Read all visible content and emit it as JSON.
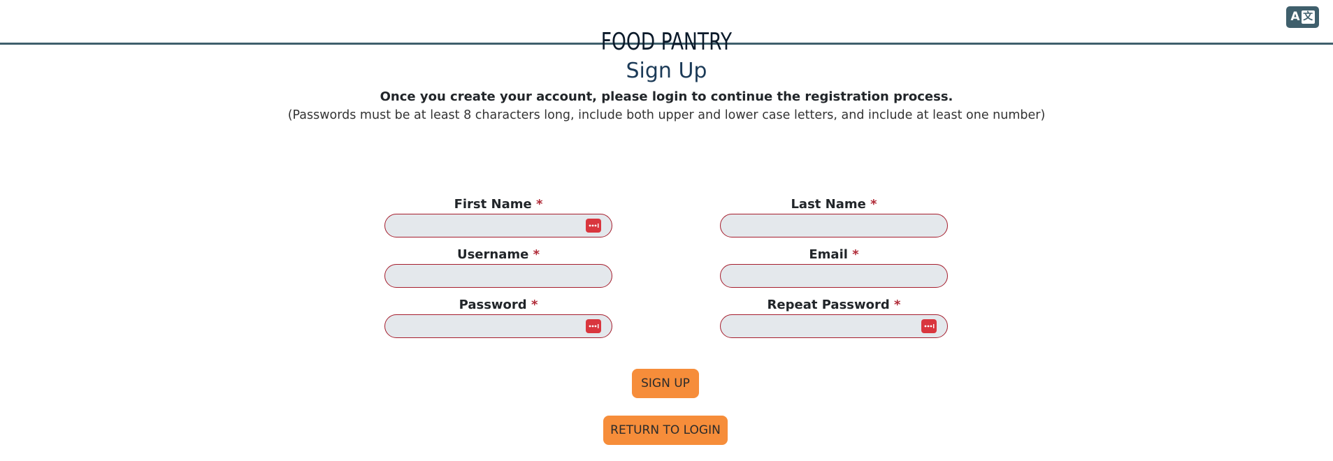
{
  "header": {
    "translate_icon": "translate-icon",
    "translate_glyph_a": "A",
    "translate_glyph_b": "文"
  },
  "main": {
    "brand": "FOOD PANTRY",
    "title": "Sign Up",
    "notice": "Once you create your account, please login to continue the registration process.",
    "password_rules": "(Passwords must be at least 8 characters long, include both upper and lower case letters, and include at least one number)"
  },
  "form": {
    "required_mark": "*",
    "first_name": {
      "label": "First Name",
      "value": ""
    },
    "last_name": {
      "label": "Last Name",
      "value": ""
    },
    "username": {
      "label": "Username",
      "value": ""
    },
    "email": {
      "label": "Email",
      "value": ""
    },
    "password": {
      "label": "Password",
      "value": ""
    },
    "repeat_password": {
      "label": "Repeat Password",
      "value": ""
    }
  },
  "actions": {
    "sign_up": "SIGN UP",
    "return_to_login": "RETURN TO LOGIN"
  },
  "colors": {
    "header_border": "#3f5f6c",
    "input_border": "#a51d2d",
    "input_bg": "#e4e8ec",
    "button_bg": "#f68d3a",
    "password_manager_badge": "#d9363e"
  }
}
